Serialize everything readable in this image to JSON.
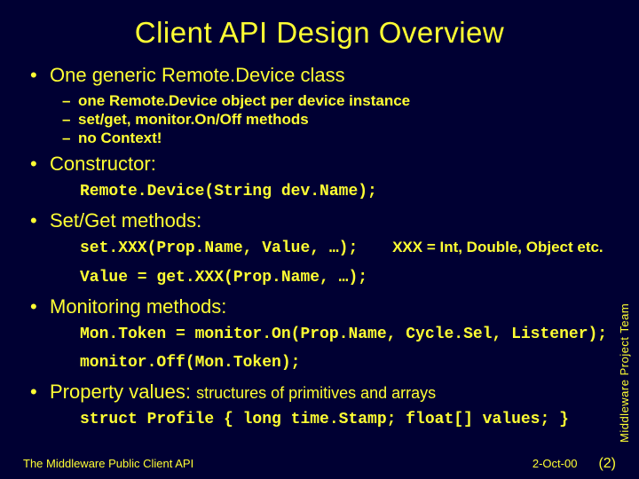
{
  "title": "Client API Design Overview",
  "bullets": {
    "b1": "One generic Remote.Device class",
    "b1_sub": [
      "one Remote.Device object per device instance",
      "set/get, monitor.On/Off methods",
      "no Context!"
    ],
    "b2": "Constructor:",
    "b2_code": "Remote.Device(String dev.Name);",
    "b3": "Set/Get methods:",
    "b3_code1": "set.XXX(Prop.Name, Value, …);",
    "b3_annot": "XXX = Int, Double, Object etc.",
    "b3_code2": "Value = get.XXX(Prop.Name, …);",
    "b4": "Monitoring methods:",
    "b4_code1": "Mon.Token = monitor.On(Prop.Name, Cycle.Sel, Listener);",
    "b4_code2": "monitor.Off(Mon.Token);",
    "b5_a": "Property values: ",
    "b5_b": "structures of primitives and arrays",
    "b5_code": "struct Profile { long time.Stamp; float[] values; }"
  },
  "side_label": "Middleware Project Team",
  "footer": {
    "left": "The Middleware Public Client API",
    "date": "2-Oct-00",
    "page": "(2)"
  }
}
